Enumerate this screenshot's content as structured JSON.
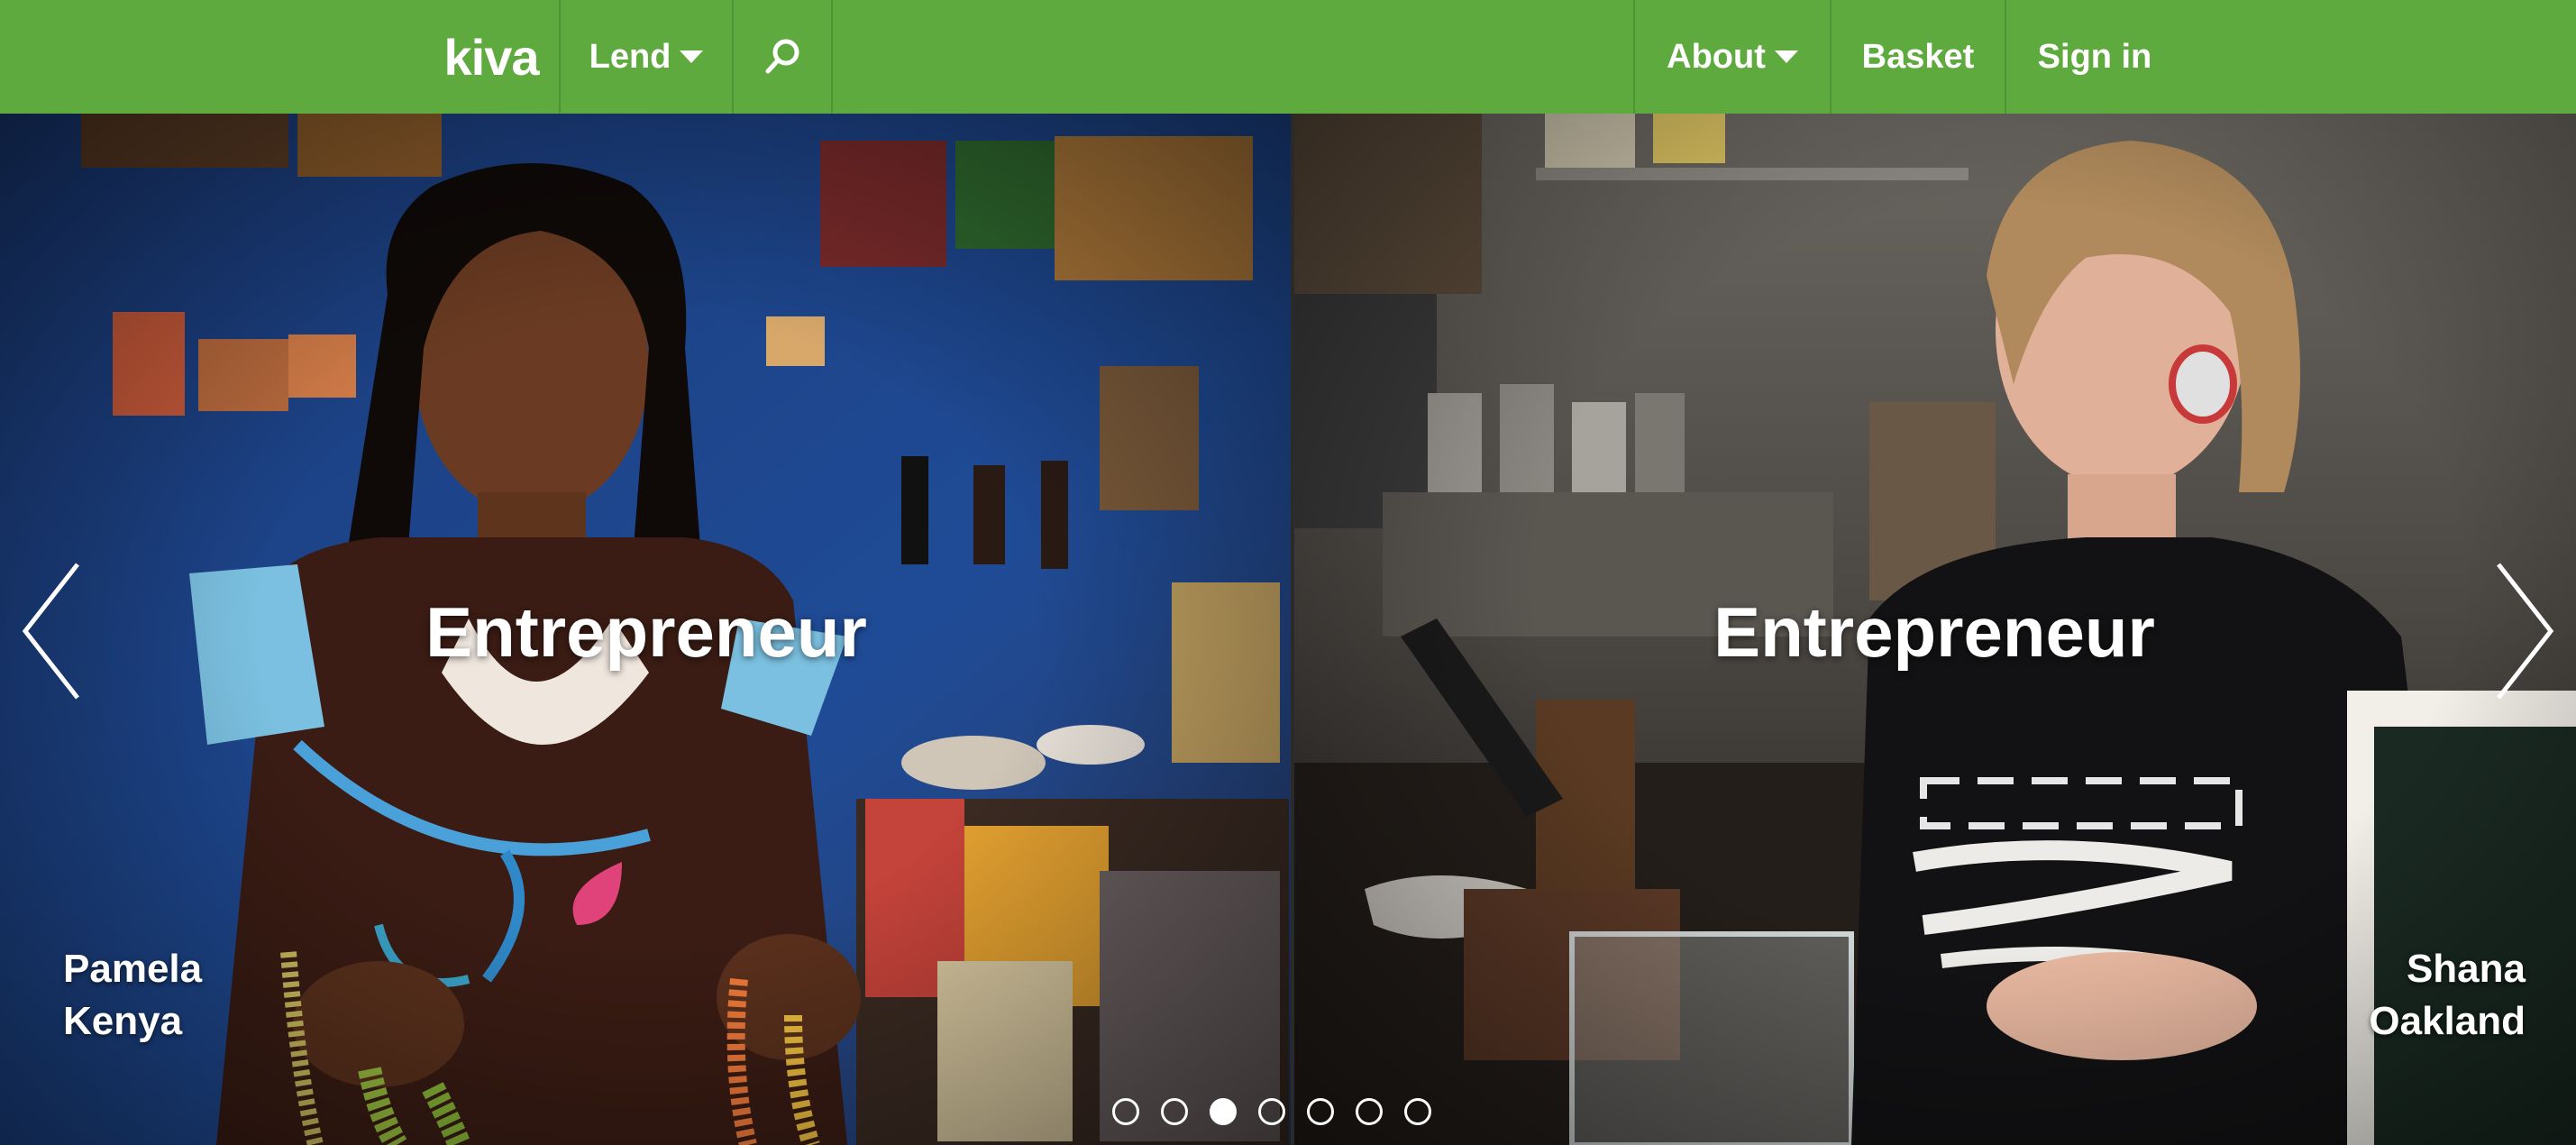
{
  "nav": {
    "logo": "kiva",
    "lend_label": "Lend",
    "search_icon": "search-icon",
    "about_label": "About",
    "basket_label": "Basket",
    "signin_label": "Sign in",
    "bar_color": "#5faa3e"
  },
  "slides": [
    {
      "title": "Entrepreneur",
      "name": "Pamela",
      "location": "Kenya"
    },
    {
      "title": "Entrepreneur",
      "name": "Shana",
      "location": "Oakland"
    }
  ],
  "carousel": {
    "dot_count": 7,
    "active_dot": 3,
    "prev_icon": "chevron-left-icon",
    "next_icon": "chevron-right-icon"
  }
}
